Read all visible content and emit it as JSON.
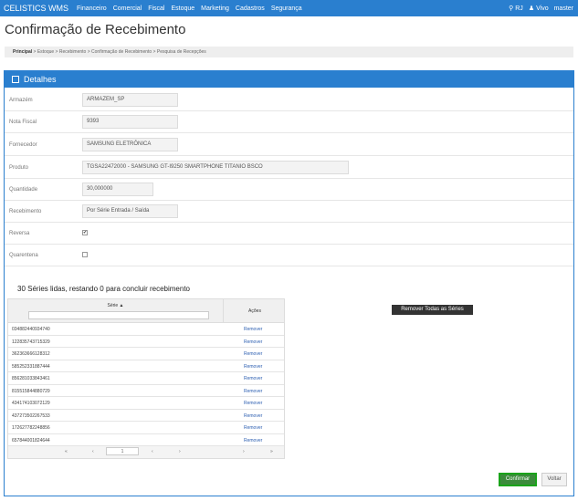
{
  "navbar": {
    "brand": "CELISTICS WMS",
    "items": [
      "Financeiro",
      "Comercial",
      "Fiscal",
      "Estoque",
      "Marketing",
      "Cadastros",
      "Segurança"
    ],
    "location": "RJ",
    "user": "Vivo",
    "role": "master"
  },
  "page": {
    "title": "Confirmação de Recebimento"
  },
  "breadcrumb": {
    "root": "Principal",
    "path": " > Estoque > Recebimento > Confirmação de Recebimento > Pesquisa de Recepções"
  },
  "panel": {
    "title": "Detalhes"
  },
  "form": {
    "armazem": {
      "label": "Armazém",
      "value": "ARMAZEM_SP"
    },
    "nota_fiscal": {
      "label": "Nota Fiscal",
      "value": "9393"
    },
    "fornecedor": {
      "label": "Fornecedor",
      "value": "SAMSUNG ELETRÔNICA"
    },
    "produto": {
      "label": "Produto",
      "value": "TGSA22472000 - SAMSUNG GT-I9250 SMARTPHONE TITANIO BSCO"
    },
    "quantidade": {
      "label": "Quantidade",
      "value": "30,000000"
    },
    "recebimento": {
      "label": "Recebimento",
      "value": "Por Série Entrada / Saída"
    },
    "reversa": {
      "label": "Reversa",
      "checked": true
    },
    "quarentena": {
      "label": "Quarentena",
      "checked": false
    }
  },
  "series": {
    "summary": "30 Séries lidas, restando 0 para concluir recebimento",
    "remove_all_label": "Remover Todas as Séries",
    "col_serie": "Série ▲",
    "col_acoes": "Ações",
    "rows": [
      {
        "serie": "034882440934740",
        "action": "Remover"
      },
      {
        "serie": "122835743715329",
        "action": "Remover"
      },
      {
        "serie": "362363666128312",
        "action": "Remover"
      },
      {
        "serie": "585252331887444",
        "action": "Remover"
      },
      {
        "serie": "856281033843461",
        "action": "Remover"
      },
      {
        "serie": "815515844880729",
        "action": "Remover"
      },
      {
        "serie": "434174103072129",
        "action": "Remover"
      },
      {
        "serie": "437273502267533",
        "action": "Remover"
      },
      {
        "serie": "172627782248856",
        "action": "Remover"
      },
      {
        "serie": "657844001824644",
        "action": "Remover"
      }
    ],
    "pagination": {
      "first": "«",
      "prev": "‹",
      "current": "1",
      "next": "›",
      "last": "»",
      "next2": "›",
      "last2": "»"
    }
  },
  "actions": {
    "confirm_label": "Confirmar",
    "back_label": "Voltar"
  }
}
